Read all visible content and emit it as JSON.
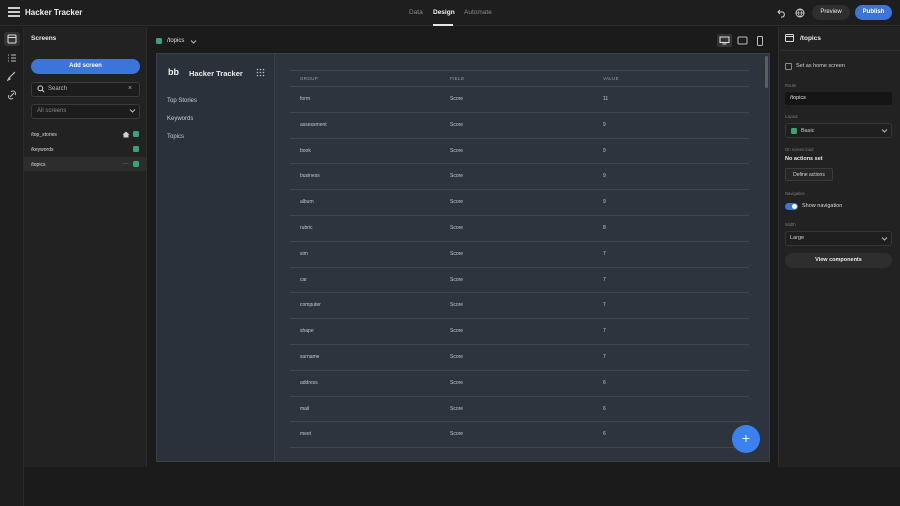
{
  "app": {
    "title": "Hacker Tracker",
    "tabs": [
      {
        "label": "Data",
        "active": false
      },
      {
        "label": "Design",
        "active": true
      },
      {
        "label": "Automate",
        "active": false
      }
    ],
    "preview_label": "Preview",
    "publish_label": "Publish",
    "accent_color": "#3b75d9"
  },
  "screens_panel": {
    "title": "Screens",
    "add_button": "Add screen",
    "search_placeholder": "Search",
    "filter_value": "All screens",
    "routes": [
      {
        "path": "/top_stories",
        "home": true
      },
      {
        "path": "/keywords",
        "home": false
      },
      {
        "path": "/topics",
        "home": false,
        "active": true
      }
    ]
  },
  "canvas": {
    "screen_name": "/topics",
    "devices": [
      "desktop-icon",
      "tablet-icon",
      "mobile-icon"
    ]
  },
  "preview_app": {
    "logo": "bb",
    "name": "Hacker Tracker",
    "nav": [
      "Top Stories",
      "Keywords",
      "Topics"
    ],
    "table": {
      "headers": [
        "GROUP",
        "FIELD",
        "VALUE"
      ],
      "rows": [
        [
          "form",
          "Score",
          "11"
        ],
        [
          "assessment",
          "Score",
          "9"
        ],
        [
          "book",
          "Score",
          "9"
        ],
        [
          "business",
          "Score",
          "9"
        ],
        [
          "album",
          "Score",
          "9"
        ],
        [
          "rubric",
          "Score",
          "8"
        ],
        [
          "sim",
          "Score",
          "7"
        ],
        [
          "car",
          "Score",
          "7"
        ],
        [
          "computer",
          "Score",
          "7"
        ],
        [
          "shape",
          "Score",
          "7"
        ],
        [
          "surname",
          "Score",
          "7"
        ],
        [
          "address",
          "Score",
          "6"
        ],
        [
          "mail",
          "Score",
          "6"
        ],
        [
          "meet",
          "Score",
          "6"
        ]
      ]
    },
    "fab_label": "+"
  },
  "right_panel": {
    "title": "/topics",
    "home_checkbox_label": "Set as home screen",
    "route_label": "Route",
    "route_value": "/topics",
    "layout_label": "Layout",
    "layout_value": "Basic",
    "actions_label": "On screen load",
    "actions_value": "No actions set",
    "define_actions_button": "Define actions",
    "navigation_label": "Navigation",
    "navigation_toggle_label": "Show navigation",
    "width_label": "Width",
    "width_value": "Large",
    "view_components_button": "View components"
  }
}
